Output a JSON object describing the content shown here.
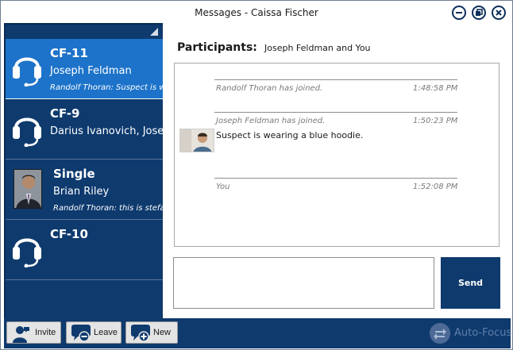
{
  "window": {
    "title": "Messages - Caissa Fischer"
  },
  "conversations": [
    {
      "name": "CF-11",
      "subtitle": "Joseph Feldman",
      "last_message": "Randolf Thoran: Suspect is w",
      "selected": true,
      "icon": "headset-icon"
    },
    {
      "name": "CF-9",
      "subtitle": "Darius Ivanovich, Josep",
      "last_message": "",
      "selected": false,
      "icon": "headset-icon"
    },
    {
      "name": "Single",
      "subtitle": "Brian Riley",
      "last_message": "Randolf Thoran: this is stefa",
      "selected": false,
      "icon": "user-photo"
    },
    {
      "name": "CF-10",
      "subtitle": "",
      "last_message": "",
      "selected": false,
      "icon": "headset-icon"
    }
  ],
  "chat": {
    "participants_label": "Participants:",
    "participants_value": "Joseph Feldman and You",
    "messages": [
      {
        "from": "Randolf Thoran has joined.",
        "time": "1:48:58 PM",
        "text": ""
      },
      {
        "from": "Joseph Feldman has joined.",
        "time": "1:50:23 PM",
        "text": "Suspect is wearing a blue hoodie."
      },
      {
        "from": "You",
        "time": "1:52:08 PM",
        "text": ""
      }
    ],
    "compose_value": "",
    "send_label": "Send"
  },
  "toolbar": {
    "invite_label": "Invite",
    "leave_label": "Leave",
    "new_label": "New",
    "autofocus_label": "Auto-Focus"
  },
  "colors": {
    "navy": "#0e3a6e",
    "selected_blue": "#1d73c9",
    "autofocus_text": "#5f7ea9"
  }
}
